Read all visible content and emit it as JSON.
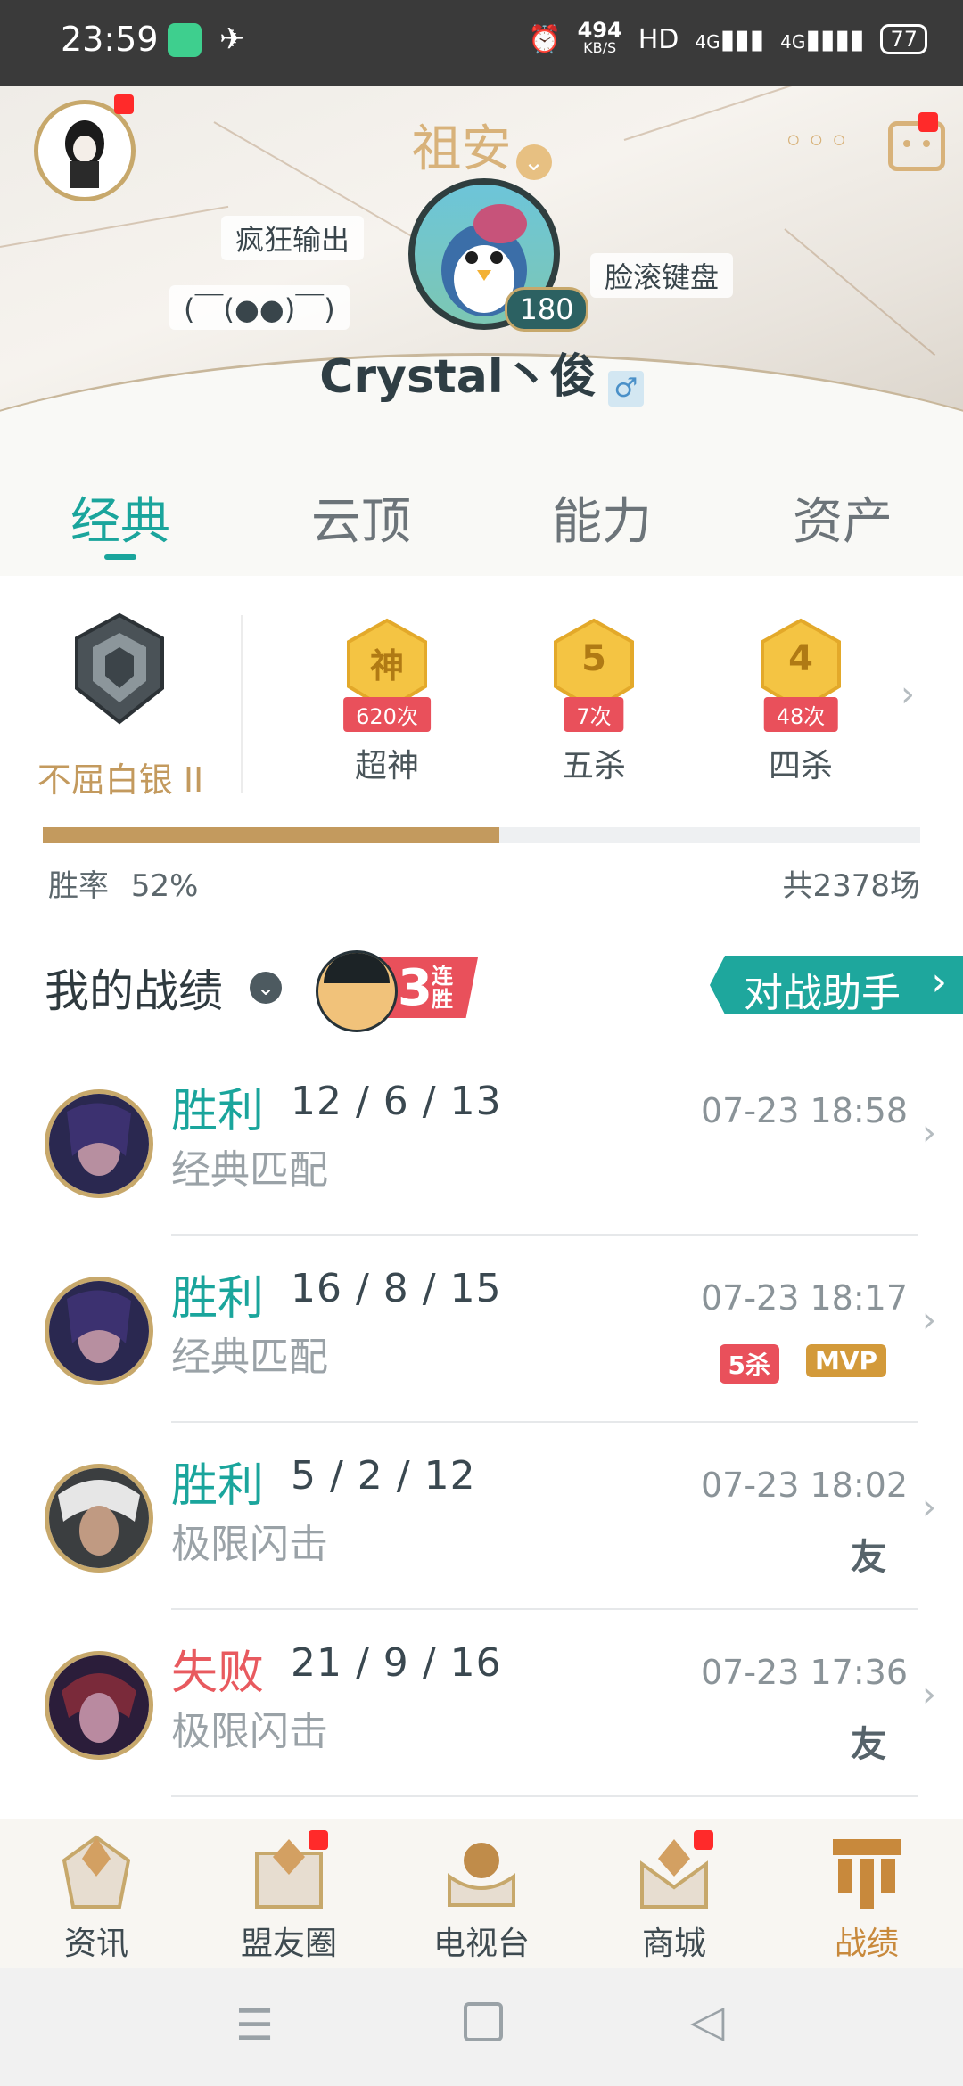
{
  "status_bar": {
    "time": "23:59",
    "speed": "494",
    "speed_unit": "KB/S",
    "hd": "HD",
    "net1": "4G",
    "net2": "4G",
    "battery": "77"
  },
  "profile": {
    "location": "祖安",
    "nickname": "Crystal丶俊",
    "gender_icon": "male-icon",
    "level": "180",
    "tags": [
      "疯狂输出",
      "(￣(●●)￣)",
      "脸滚键盘"
    ],
    "more_icon": "more-icon",
    "message_icon": "chat-icon"
  },
  "tabs": [
    {
      "label": "经典",
      "active": true
    },
    {
      "label": "云顶",
      "active": false
    },
    {
      "label": "能力",
      "active": false
    },
    {
      "label": "资产",
      "active": false
    }
  ],
  "rank": {
    "label": "不屈白银 II"
  },
  "achievements": [
    {
      "badge": "神",
      "count": "620次",
      "label": "超神"
    },
    {
      "badge": "5",
      "count": "7次",
      "label": "五杀"
    },
    {
      "badge": "4",
      "count": "48次",
      "label": "四杀"
    }
  ],
  "winrate": {
    "label": "胜率",
    "value": "52%",
    "fraction": 0.52,
    "total": "共2378场"
  },
  "record": {
    "title": "我的战绩",
    "streak_num": "3",
    "streak_text": "连胜",
    "assistant_button": "对战助手"
  },
  "matches": [
    {
      "result": "胜利",
      "win": true,
      "kda": "12 / 6 / 13",
      "mode": "经典匹配",
      "time": "07-23 18:58",
      "chips": []
    },
    {
      "result": "胜利",
      "win": true,
      "kda": "16 / 8 / 15",
      "mode": "经典匹配",
      "time": "07-23 18:17",
      "chips": [
        "5杀",
        "MVP"
      ]
    },
    {
      "result": "胜利",
      "win": true,
      "kda": "5 / 2 / 12",
      "mode": "极限闪击",
      "time": "07-23 18:02",
      "chips": [
        "友"
      ]
    },
    {
      "result": "失败",
      "win": false,
      "kda": "21 / 9 / 16",
      "mode": "极限闪击",
      "time": "07-23 17:36",
      "chips": [
        "友"
      ]
    }
  ],
  "bottom_nav": [
    {
      "label": "资讯",
      "dot": false,
      "active": false
    },
    {
      "label": "盟友圈",
      "dot": true,
      "active": false
    },
    {
      "label": "电视台",
      "dot": false,
      "active": false
    },
    {
      "label": "商城",
      "dot": true,
      "active": false
    },
    {
      "label": "战绩",
      "dot": false,
      "active": true
    }
  ],
  "colors": {
    "accent": "#1aa59c",
    "win": "#1aa59c",
    "loss": "#e85a5f",
    "gold": "#c7a86b"
  }
}
